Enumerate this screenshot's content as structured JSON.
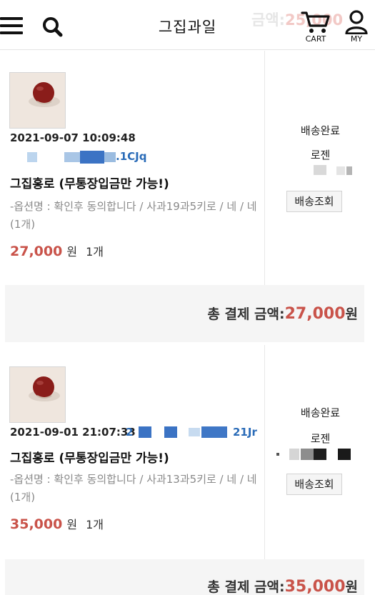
{
  "header": {
    "title": "그집과일",
    "faded_total_label": "금액:",
    "faded_total_amount": "25,000",
    "cart_label": "CART",
    "my_label": "MY"
  },
  "orders": [
    {
      "datetime": "2021-09-07 10:09:48",
      "order_code_partial": ".1CJq",
      "product_name": "그집홍로 (무통장입금만 가능!)",
      "option": "-옵션명 : 확인후 동의합니다 / 사과19과5키로 / 네 / 네 (1개)",
      "price": "27,000",
      "currency_unit": "원",
      "quantity": "1개",
      "status": "배송완료",
      "courier": "로젠",
      "track_button": "배송조회",
      "total_label": "총 결제 금액:",
      "total_amount": "27,000",
      "total_unit": "원"
    },
    {
      "datetime": "2021-09-01 21:07:33",
      "order_code_partial": "21Jr",
      "order_code_prefix": "2",
      "product_name": "그집홍로 (무통장입금만 가능!)",
      "option": "-옵션명 : 확인후 동의합니다 / 사과13과5키로 / 네 / 네 (1개)",
      "price": "35,000",
      "currency_unit": "원",
      "quantity": "1개",
      "status": "배송완료",
      "courier": "로젠",
      "track_button": "배송조회",
      "total_label": "총 결제 금액:",
      "total_amount": "35,000",
      "total_unit": "원"
    }
  ],
  "icons": {
    "menu": "hamburger-menu-icon",
    "search": "search-icon",
    "cart": "cart-icon",
    "my": "user-icon"
  },
  "colors": {
    "price": "#c9534a",
    "order_code": "#2b6cb8",
    "total_bar": "#f5f5f5"
  }
}
